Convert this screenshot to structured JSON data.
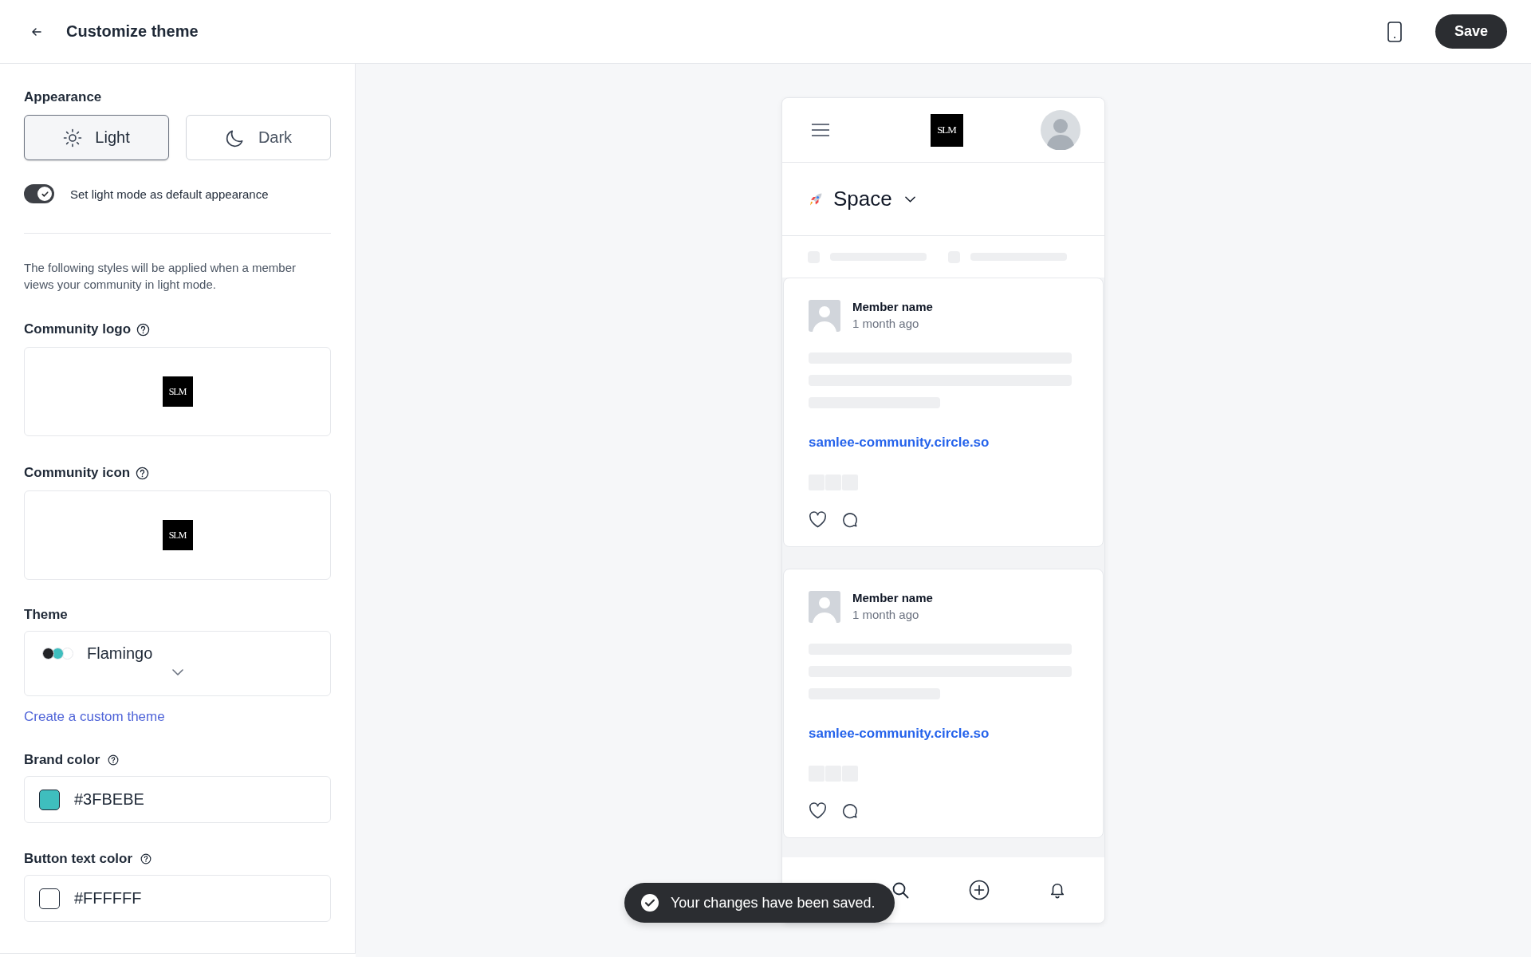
{
  "header": {
    "title": "Customize theme",
    "save_label": "Save"
  },
  "appearance": {
    "label": "Appearance",
    "options": [
      {
        "label": "Light",
        "kind": "sun",
        "selected": true
      },
      {
        "label": "Dark",
        "kind": "moon",
        "selected": false
      }
    ],
    "default_toggle": {
      "label": "Set light mode as default appearance",
      "on": true
    }
  },
  "description": "The following styles will be applied when a member views your community in light mode.",
  "logo_sections": [
    {
      "label": "Community logo",
      "logo_text": "SLM"
    },
    {
      "label": "Community icon",
      "logo_text": "SLM"
    }
  ],
  "theme": {
    "label": "Theme",
    "value": "Flamingo",
    "swatches": [
      {
        "color": "#222327"
      },
      {
        "color": "#3fbebe"
      },
      {
        "color": "#ffffff"
      }
    ]
  },
  "custom_theme_link": "Create a custom theme",
  "colors": [
    {
      "label": "Brand color",
      "value": "#3FBEBE",
      "color": "#3fbebe"
    },
    {
      "label": "Button text color",
      "value": "#FFFFFF",
      "color": "#ffffff"
    }
  ],
  "preview": {
    "logo_text": "SLM",
    "space_title": "Space",
    "posts": [
      {
        "author": "Member name",
        "time": "1 month ago",
        "link": "samlee-community.circle.so"
      },
      {
        "author": "Member name",
        "time": "1 month ago",
        "link": "samlee-community.circle.so"
      }
    ],
    "nav": [
      {
        "kind": "search"
      },
      {
        "kind": "plus"
      },
      {
        "kind": "bell"
      }
    ]
  },
  "toast": {
    "message": "Your changes have been saved."
  }
}
